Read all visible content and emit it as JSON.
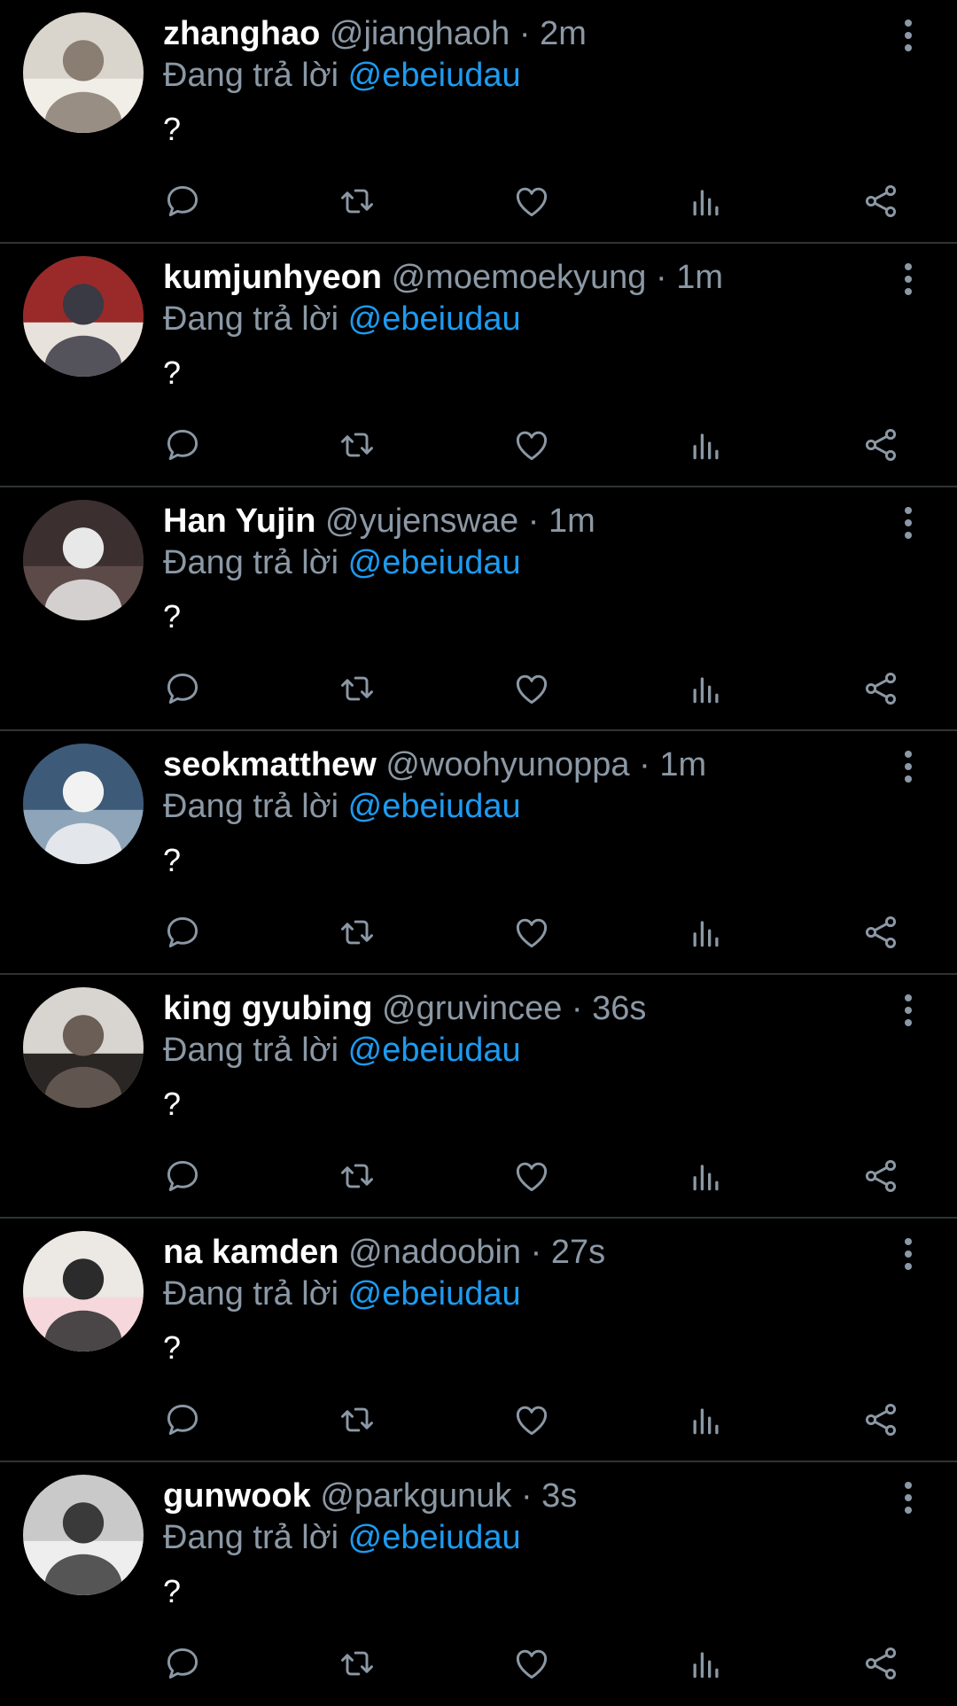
{
  "reply_prefix": "Đang trả lời",
  "reply_to": "@ebeiudau",
  "separator": "·",
  "colors": {
    "background": "#000000",
    "secondary": "#8b98a5",
    "accent": "#1d9bf0",
    "divider": "#2f3336"
  },
  "icons": [
    "more-vertical-icon",
    "reply-icon",
    "retweet-icon",
    "like-icon",
    "views-icon",
    "share-icon"
  ],
  "tweets": [
    {
      "name": "zhanghao",
      "handle": "@jianghaoh",
      "time": "2m",
      "text": "?"
    },
    {
      "name": "kumjunhyeon",
      "handle": "@moemoekyung",
      "time": "1m",
      "text": "?"
    },
    {
      "name": "Han Yujin",
      "handle": "@yujenswae",
      "time": "1m",
      "text": "?"
    },
    {
      "name": "seokmatthew",
      "handle": "@woohyunoppa",
      "time": "1m",
      "text": "?"
    },
    {
      "name": "king gyubing",
      "handle": "@gruvincee",
      "time": "36s",
      "text": "?"
    },
    {
      "name": "na kamden",
      "handle": "@nadoobin",
      "time": "27s",
      "text": "?"
    },
    {
      "name": "gunwook",
      "handle": "@parkgunuk",
      "time": "3s",
      "text": "?"
    }
  ]
}
